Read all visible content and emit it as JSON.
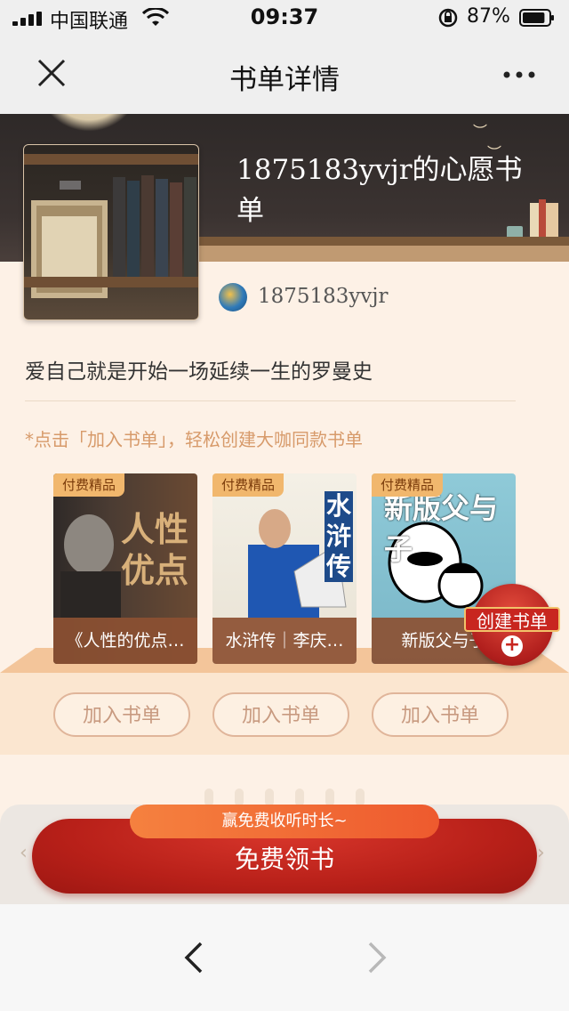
{
  "status_bar": {
    "carrier": "中国联通",
    "time": "09:37",
    "battery_percent": "87%",
    "battery_level": 0.87
  },
  "nav": {
    "title": "书单详情",
    "close_icon": "close-icon",
    "more_icon": "more-icon"
  },
  "booklist": {
    "title": "1875183yvjr的心愿书单",
    "author": "1875183yvjr",
    "description": "爱自己就是开始一场延续一生的罗曼史",
    "hint": "*点击「加入书单」，轻松创建大咖同款书单"
  },
  "books": [
    {
      "badge": "付费精品",
      "caption": "《人性的优点…",
      "cover_text": "人性的优点"
    },
    {
      "badge": "付费精品",
      "caption": "水浒传｜李庆…",
      "cover_text": "水浒传"
    },
    {
      "badge": "付费精品",
      "caption": "新版父与子",
      "cover_text": "新版父与子"
    }
  ],
  "add_button_label": "加入书单",
  "create_badge": {
    "label": "创建书单",
    "plus": "+"
  },
  "cta": {
    "tip": "赢免费收听时长~",
    "button": "免费领书"
  },
  "colors": {
    "accent_red": "#b82019",
    "tip_orange": "#f07a3a",
    "hint_color": "#d79a6a"
  }
}
